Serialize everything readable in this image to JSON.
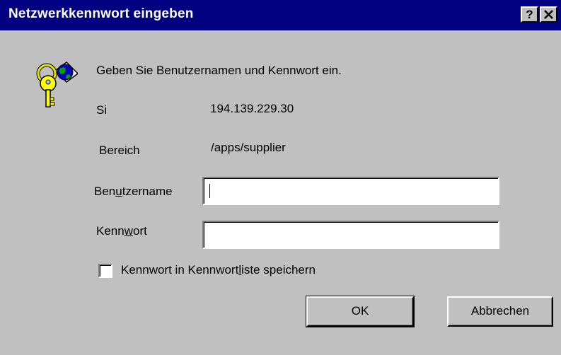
{
  "window": {
    "title": "Netzwerkkennwort eingeben",
    "help_symbol": "?",
    "close_symbol": "✕"
  },
  "dialog": {
    "prompt": "Geben Sie Benutzernamen und Kennwort ein.",
    "site_label": "Si",
    "site_value": "194.139.229.30",
    "realm_label": "Bereich",
    "realm_value": "/apps/supplier",
    "username_label_pre": "Ben",
    "username_label_ul": "u",
    "username_label_post": "tzername",
    "username_value": "",
    "password_label_pre": "Kenn",
    "password_label_ul": "w",
    "password_label_post": "ort",
    "password_value": "",
    "save_checkbox_pre": "Kennwort in Kennwort",
    "save_checkbox_ul": "l",
    "save_checkbox_post": "iste speichern",
    "save_checked": false
  },
  "buttons": {
    "ok": "OK",
    "cancel": "Abbrechen"
  },
  "icons": {
    "dialog_icon": "keys-globe-icon"
  },
  "colors": {
    "titlebar": "#000080",
    "face": "#c0c0c0"
  }
}
